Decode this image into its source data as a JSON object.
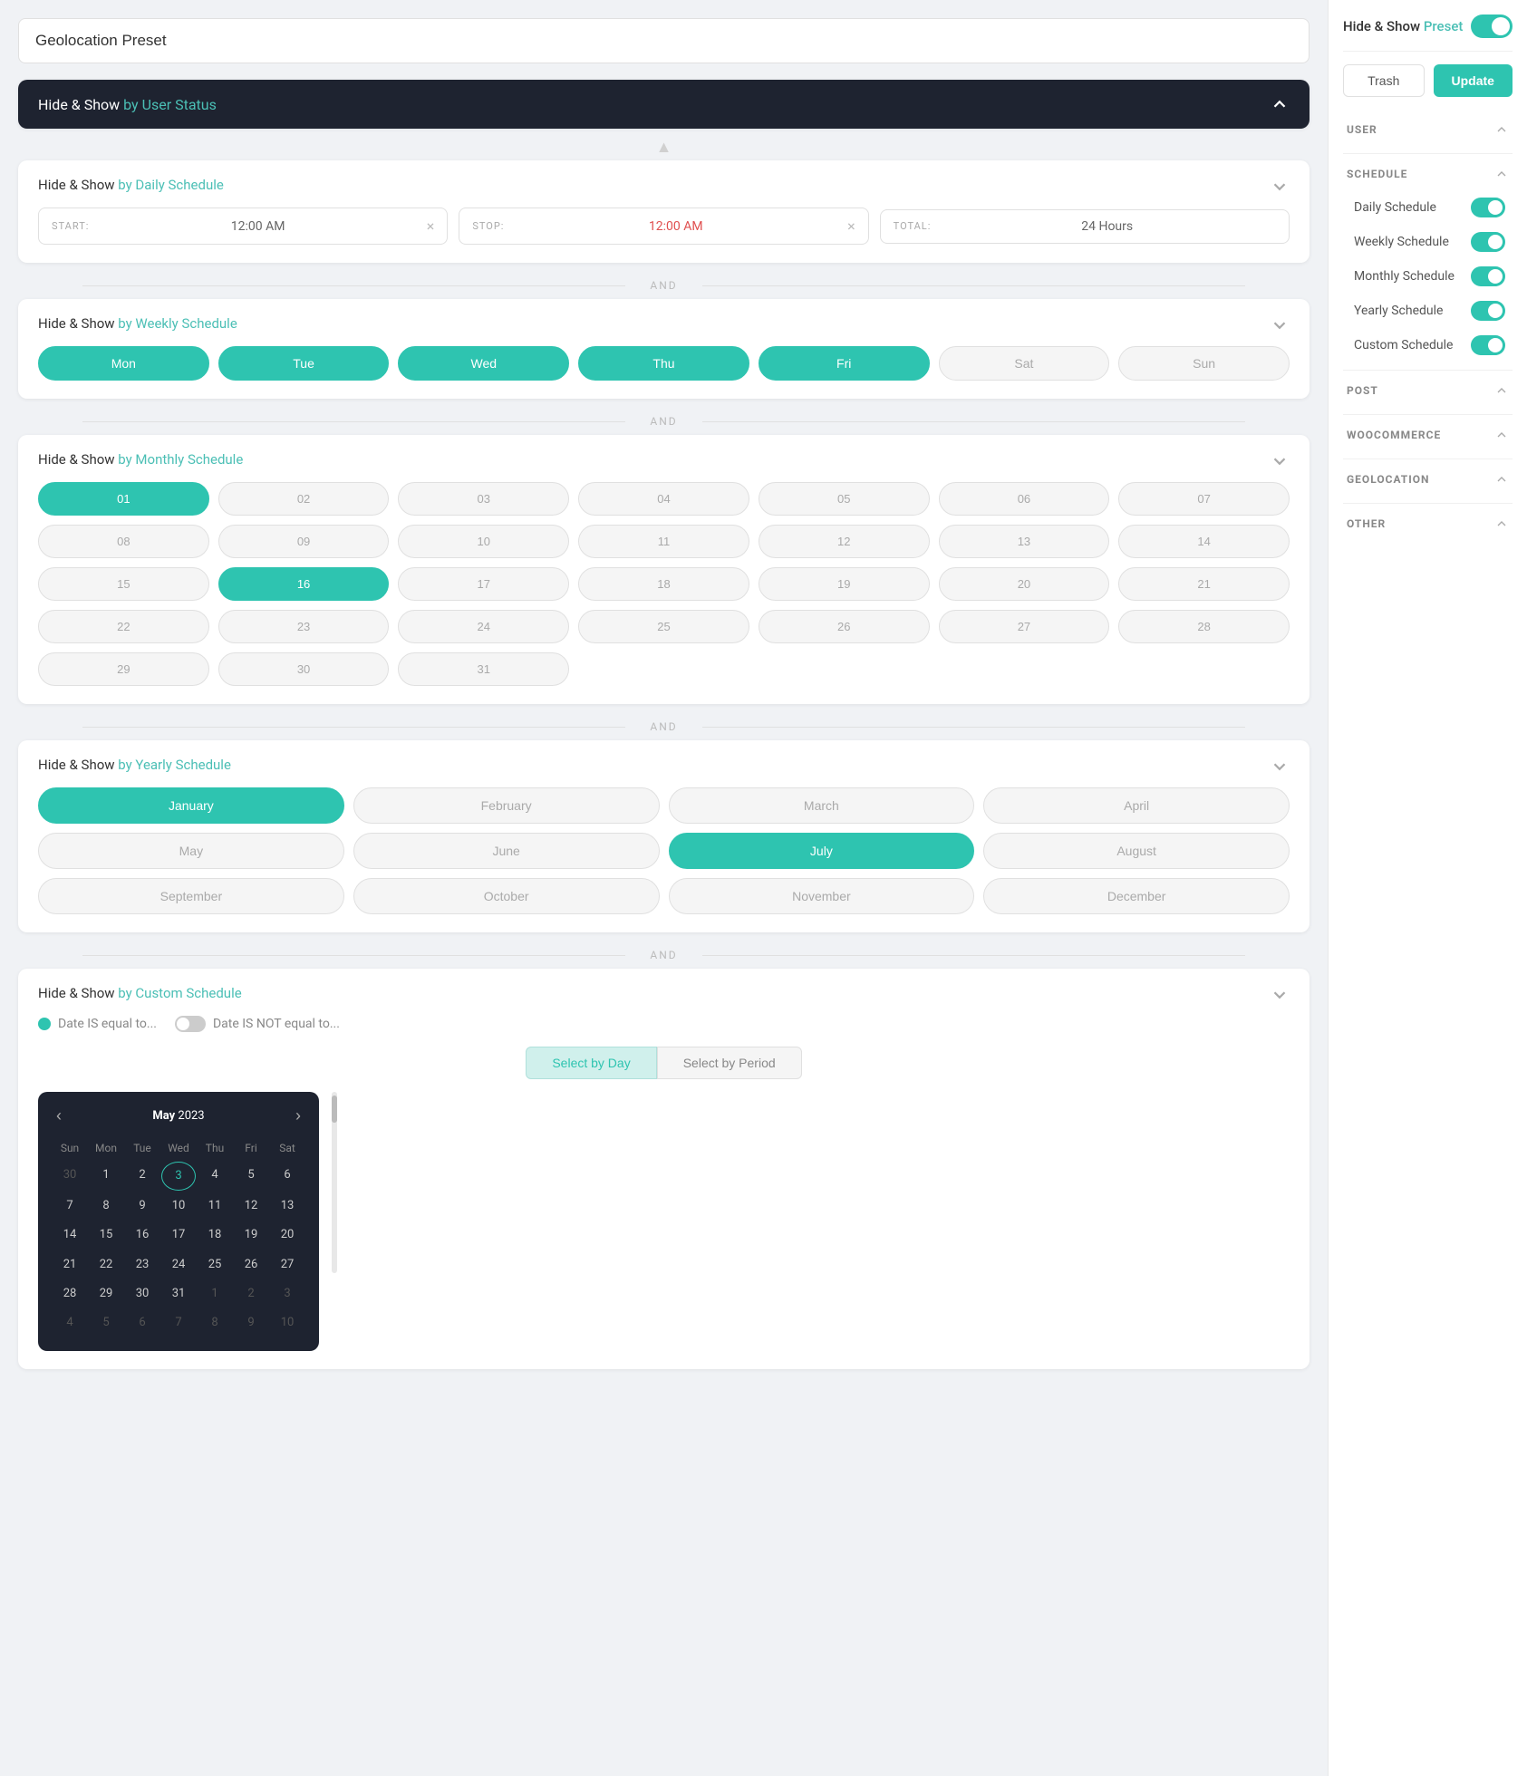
{
  "page": {
    "title_placeholder": "Geolocation Preset"
  },
  "user_status_section": {
    "label": "Hide & Show",
    "accent": " by User Status"
  },
  "daily_schedule": {
    "title": "Hide & Show",
    "accent": " by Daily Schedule",
    "start_label": "START:",
    "start_value": "12:00 AM",
    "stop_label": "STOP:",
    "stop_value": "12:00 AM",
    "total_label": "TOTAL:",
    "total_value": "24 Hours"
  },
  "weekly_schedule": {
    "title": "Hide & Show",
    "accent": " by Weekly Schedule",
    "days": [
      {
        "label": "Mon",
        "active": true
      },
      {
        "label": "Tue",
        "active": true
      },
      {
        "label": "Wed",
        "active": true
      },
      {
        "label": "Thu",
        "active": true
      },
      {
        "label": "Fri",
        "active": true
      },
      {
        "label": "Sat",
        "active": false
      },
      {
        "label": "Sun",
        "active": false
      }
    ]
  },
  "monthly_schedule": {
    "title": "Hide & Show",
    "accent": " by Monthly Schedule",
    "days": [
      {
        "label": "01",
        "active": true
      },
      {
        "label": "02",
        "active": false
      },
      {
        "label": "03",
        "active": false
      },
      {
        "label": "04",
        "active": false
      },
      {
        "label": "05",
        "active": false
      },
      {
        "label": "06",
        "active": false
      },
      {
        "label": "07",
        "active": false
      },
      {
        "label": "08",
        "active": false
      },
      {
        "label": "09",
        "active": false
      },
      {
        "label": "10",
        "active": false
      },
      {
        "label": "11",
        "active": false
      },
      {
        "label": "12",
        "active": false
      },
      {
        "label": "13",
        "active": false
      },
      {
        "label": "14",
        "active": false
      },
      {
        "label": "15",
        "active": false
      },
      {
        "label": "16",
        "active": true
      },
      {
        "label": "17",
        "active": false
      },
      {
        "label": "18",
        "active": false
      },
      {
        "label": "19",
        "active": false
      },
      {
        "label": "20",
        "active": false
      },
      {
        "label": "21",
        "active": false
      },
      {
        "label": "22",
        "active": false
      },
      {
        "label": "23",
        "active": false
      },
      {
        "label": "24",
        "active": false
      },
      {
        "label": "25",
        "active": false
      },
      {
        "label": "26",
        "active": false
      },
      {
        "label": "27",
        "active": false
      },
      {
        "label": "28",
        "active": false
      },
      {
        "label": "29",
        "active": false
      },
      {
        "label": "30",
        "active": false
      },
      {
        "label": "31",
        "active": false
      }
    ]
  },
  "yearly_schedule": {
    "title": "Hide & Show",
    "accent": " by Yearly Schedule",
    "months": [
      {
        "label": "January",
        "active": true
      },
      {
        "label": "February",
        "active": false
      },
      {
        "label": "March",
        "active": false
      },
      {
        "label": "April",
        "active": false
      },
      {
        "label": "May",
        "active": false
      },
      {
        "label": "June",
        "active": false
      },
      {
        "label": "July",
        "active": true
      },
      {
        "label": "August",
        "active": false
      },
      {
        "label": "September",
        "active": false
      },
      {
        "label": "October",
        "active": false
      },
      {
        "label": "November",
        "active": false
      },
      {
        "label": "December",
        "active": false
      }
    ]
  },
  "custom_schedule": {
    "title": "Hide & Show",
    "accent": " by Custom Schedule",
    "date_is_label": "Date IS equal to...",
    "date_is_not_label": "Date IS NOT equal to...",
    "tab_day": "Select by Day",
    "tab_period": "Select by Period",
    "calendar": {
      "month": "May",
      "year": "2023",
      "day_headers": [
        "Sun",
        "Mon",
        "Tue",
        "Wed",
        "Thu",
        "Fri",
        "Sat"
      ],
      "weeks": [
        [
          {
            "label": "30",
            "type": "other-month"
          },
          {
            "label": "1",
            "type": "normal"
          },
          {
            "label": "2",
            "type": "normal"
          },
          {
            "label": "3",
            "type": "today"
          },
          {
            "label": "4",
            "type": "normal"
          },
          {
            "label": "5",
            "type": "normal"
          },
          {
            "label": "6",
            "type": "normal"
          }
        ],
        [
          {
            "label": "7",
            "type": "normal"
          },
          {
            "label": "8",
            "type": "normal"
          },
          {
            "label": "9",
            "type": "normal"
          },
          {
            "label": "10",
            "type": "normal"
          },
          {
            "label": "11",
            "type": "normal"
          },
          {
            "label": "12",
            "type": "normal"
          },
          {
            "label": "13",
            "type": "normal"
          }
        ],
        [
          {
            "label": "14",
            "type": "normal"
          },
          {
            "label": "15",
            "type": "normal"
          },
          {
            "label": "16",
            "type": "normal"
          },
          {
            "label": "17",
            "type": "normal"
          },
          {
            "label": "18",
            "type": "normal"
          },
          {
            "label": "19",
            "type": "normal"
          },
          {
            "label": "20",
            "type": "normal"
          }
        ],
        [
          {
            "label": "21",
            "type": "normal"
          },
          {
            "label": "22",
            "type": "normal"
          },
          {
            "label": "23",
            "type": "normal"
          },
          {
            "label": "24",
            "type": "normal"
          },
          {
            "label": "25",
            "type": "normal"
          },
          {
            "label": "26",
            "type": "normal"
          },
          {
            "label": "27",
            "type": "normal"
          }
        ],
        [
          {
            "label": "28",
            "type": "normal"
          },
          {
            "label": "29",
            "type": "normal"
          },
          {
            "label": "30",
            "type": "normal"
          },
          {
            "label": "31",
            "type": "normal"
          },
          {
            "label": "1",
            "type": "other-future"
          },
          {
            "label": "2",
            "type": "other-future"
          },
          {
            "label": "3",
            "type": "other-future"
          }
        ],
        [
          {
            "label": "4",
            "type": "other-future"
          },
          {
            "label": "5",
            "type": "other-future"
          },
          {
            "label": "6",
            "type": "other-future"
          },
          {
            "label": "7",
            "type": "other-future"
          },
          {
            "label": "8",
            "type": "other-future"
          },
          {
            "label": "9",
            "type": "other-future"
          },
          {
            "label": "10",
            "type": "other-future"
          }
        ]
      ]
    }
  },
  "right_panel": {
    "preset_label": "Hide & Show",
    "preset_accent": " Preset",
    "trash_btn": "Trash",
    "update_btn": "Update",
    "sections": [
      {
        "label": "USER",
        "expanded": true
      },
      {
        "label": "SCHEDULE",
        "expanded": true
      },
      {
        "label": "POST",
        "expanded": true
      },
      {
        "label": "WOOCOMMERCE",
        "expanded": true
      },
      {
        "label": "GEOLOCATION",
        "expanded": true
      },
      {
        "label": "OTHER",
        "expanded": true
      }
    ],
    "schedule_items": [
      {
        "label": "Daily Schedule",
        "on": true
      },
      {
        "label": "Weekly Schedule",
        "on": true
      },
      {
        "label": "Monthly Schedule",
        "on": true
      },
      {
        "label": "Yearly Schedule",
        "on": true
      },
      {
        "label": "Custom Schedule",
        "on": true
      }
    ]
  },
  "and_label": "AND"
}
